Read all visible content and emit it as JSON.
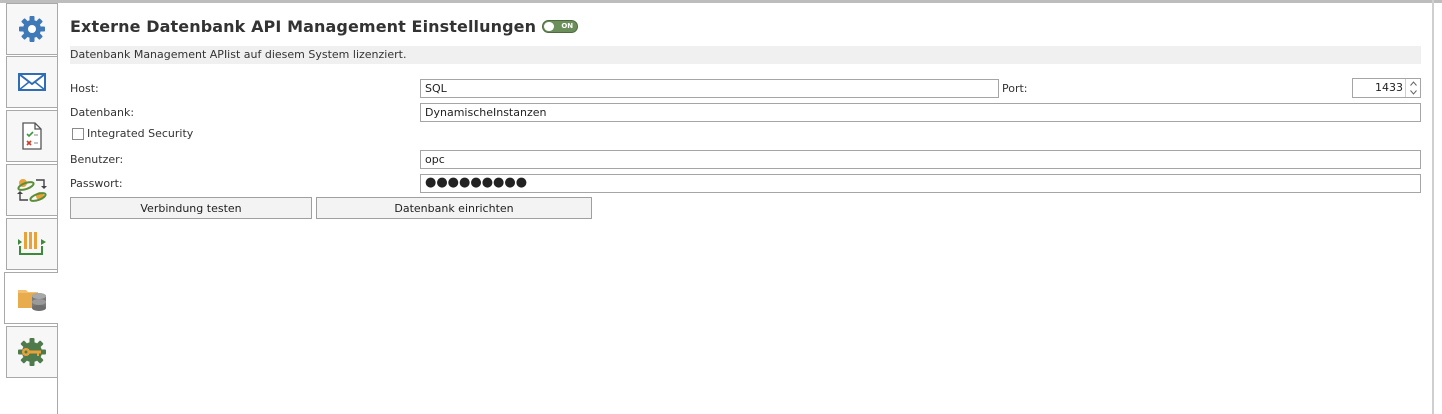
{
  "sidebar": {
    "tabs": [
      {
        "name": "general-settings",
        "icon": "gear-icon"
      },
      {
        "name": "mail-settings",
        "icon": "envelope-icon"
      },
      {
        "name": "document-validation",
        "icon": "document-check-icon"
      },
      {
        "name": "synchronization",
        "icon": "sync-icon"
      },
      {
        "name": "queue-processing",
        "icon": "queue-icon"
      },
      {
        "name": "database-management",
        "icon": "folder-database-icon",
        "active": true
      },
      {
        "name": "license-key",
        "icon": "gear-key-icon"
      }
    ]
  },
  "header": {
    "title": "Externe Datenbank API Management Einstellungen",
    "toggle_label": "ON",
    "toggle_state": "on"
  },
  "license_text": "Datenbank Management APIist auf diesem System lizenziert.",
  "form": {
    "host_label": "Host:",
    "host_value": "SQL",
    "port_label": "Port:",
    "port_value": "1433",
    "database_label": "Datenbank:",
    "database_value": "DynamischeInstanzen",
    "integrated_security_label": "Integrated Security",
    "integrated_security_checked": false,
    "user_label": "Benutzer:",
    "user_value": "opc",
    "password_label": "Passwort:",
    "password_value": "●●●●●●●●●"
  },
  "buttons": {
    "test_connection": "Verbindung testen",
    "setup_database": "Datenbank einrichten"
  },
  "colors": {
    "toggle_on": "#6b8f5a",
    "gear_blue": "#3f79b7",
    "gear_green": "#4f7a4c",
    "key_orange": "#e8a23a"
  }
}
